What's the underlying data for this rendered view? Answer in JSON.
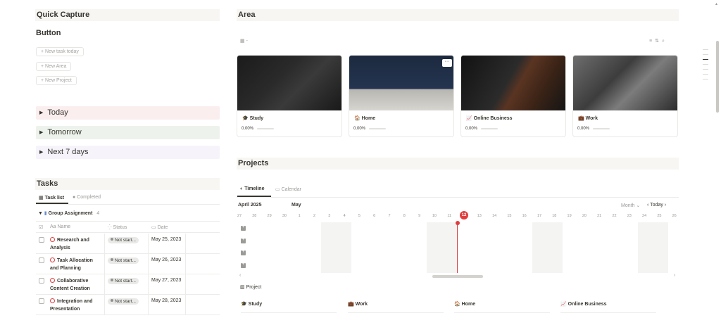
{
  "left": {
    "quick_capture": "Quick Capture",
    "button_heading": "Button",
    "buttons": [
      "New task today",
      "New Area",
      "New Project"
    ],
    "toggles": [
      "Today",
      "Tomorrow",
      "Next 7 days"
    ],
    "toggle_colors": [
      "#fbeeef",
      "#edf3ec",
      "#f6f3fb"
    ],
    "tasks": {
      "heading": "Tasks",
      "tabs": [
        "Task list",
        "Completed"
      ],
      "group": "Group Assignment",
      "group_count": "4",
      "columns": [
        "Aa Name",
        "Status",
        "Date"
      ],
      "rows": [
        {
          "name": "Research and Analysis",
          "status": "Not start...",
          "date": "May 25, 2023"
        },
        {
          "name": "Task Allocation and Planning",
          "status": "Not start...",
          "date": "May 26, 2023"
        },
        {
          "name": "Collaborative Content Creation",
          "status": "Not start...",
          "date": "May 27, 2023"
        },
        {
          "name": "Integration and Presentation",
          "status": "Not start...",
          "date": "May 28, 2023"
        }
      ]
    }
  },
  "area": {
    "heading": "Area",
    "view_label": "-",
    "cards": [
      {
        "title": "Study",
        "icon": "graduation-cap-icon",
        "progress": "0.00%"
      },
      {
        "title": "Home",
        "icon": "house-icon",
        "progress": "0.00%"
      },
      {
        "title": "Online Business",
        "icon": "chart-icon",
        "progress": "0.00%"
      },
      {
        "title": "Work",
        "icon": "briefcase-icon",
        "progress": "0.00%"
      }
    ]
  },
  "projects": {
    "heading": "Projects",
    "tabs": [
      "Timeline",
      "Calendar"
    ],
    "month_label": "April 2025",
    "next_month": "May",
    "view_mode": "Month",
    "today_label": "Today",
    "today_day": "12",
    "days": [
      "27",
      "28",
      "29",
      "30",
      "1",
      "2",
      "3",
      "4",
      "5",
      "6",
      "7",
      "8",
      "9",
      "10",
      "11",
      "12",
      "13",
      "14",
      "15",
      "16",
      "17",
      "18",
      "19",
      "20",
      "21",
      "22",
      "23",
      "24",
      "25",
      "26"
    ],
    "board_label": "Project",
    "board_columns": [
      "Study",
      "Work",
      "Home",
      "Online Business"
    ]
  },
  "colors": {
    "accent_red": "#e03e3e",
    "header_bg": "#f7f6f3"
  }
}
